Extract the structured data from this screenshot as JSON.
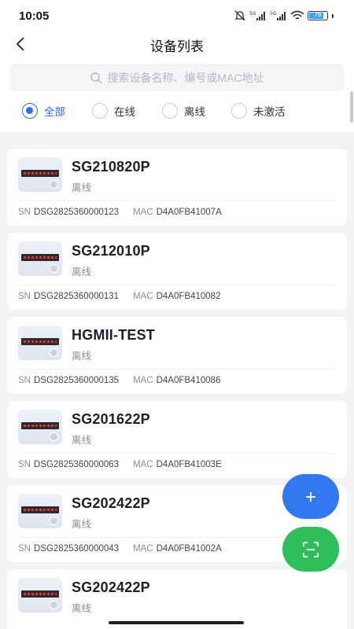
{
  "status_bar": {
    "time": "10:05",
    "battery": "75",
    "network": "5G"
  },
  "nav": {
    "title": "设备列表"
  },
  "search": {
    "placeholder": "搜索设备名称、编号或MAC地址"
  },
  "filters": [
    {
      "label": "全部",
      "selected": true
    },
    {
      "label": "在线",
      "selected": false
    },
    {
      "label": "离线",
      "selected": false
    },
    {
      "label": "未激活",
      "selected": false
    }
  ],
  "device_meta_labels": {
    "sn": "SN",
    "mac": "MAC"
  },
  "devices": [
    {
      "name": "SG210820P",
      "status": "离线",
      "sn": "DSG2825360000123",
      "mac": "D4A0FB41007A"
    },
    {
      "name": "SG212010P",
      "status": "离线",
      "sn": "DSG2825360000131",
      "mac": "D4A0FB410082"
    },
    {
      "name": "HGMII-TEST",
      "status": "离线",
      "sn": "DSG2825360000135",
      "mac": "D4A0FB410086"
    },
    {
      "name": "SG201622P",
      "status": "离线",
      "sn": "DSG2825360000063",
      "mac": "D4A0FB41003E"
    },
    {
      "name": "SG202422P",
      "status": "离线",
      "sn": "DSG2825360000043",
      "mac": "D4A0FB41002A"
    },
    {
      "name": "SG202422P",
      "status": "离线",
      "sn": "",
      "mac": ""
    }
  ],
  "fabs": {
    "add_icon": "plus-icon",
    "scan_icon": "scan-icon"
  },
  "colors": {
    "accent": "#2f6df2",
    "fab_add": "#3478f0",
    "fab_scan": "#2fbf5a",
    "offline_text": "#8a8e96"
  }
}
